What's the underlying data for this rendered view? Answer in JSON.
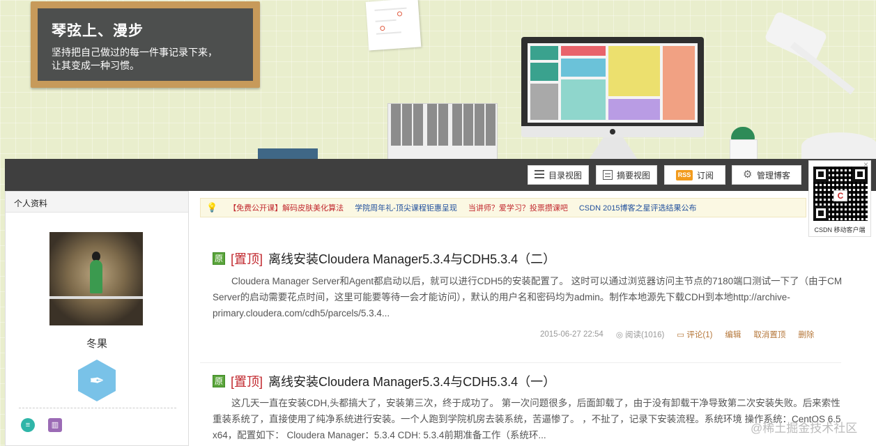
{
  "banner": {
    "title": "琴弦上、漫步",
    "subtitle_line1": "坚持把自己做过的每一件事记录下来，",
    "subtitle_line2": "让其变成一种习惯。"
  },
  "toolbar": {
    "catalog_view": "目录视图",
    "summary_view": "摘要视图",
    "rss_badge": "RSS",
    "subscribe": "订阅",
    "manage": "管理博客"
  },
  "qrcode": {
    "logo": "C",
    "caption": "CSDN 移动客户端",
    "close": "×"
  },
  "sidebar": {
    "header": "个人资料",
    "username": "冬果"
  },
  "notice": {
    "items": [
      {
        "text": "【免费公开课】解码皮肤美化算法",
        "color": "#c1272d"
      },
      {
        "text": "学院周年礼-顶尖课程钜惠呈现",
        "color": "#1f4e9c"
      },
      {
        "text": "当讲师？爱学习？投票攒课吧",
        "color": "#c1272d"
      },
      {
        "text": "CSDN 2015博客之星评选结果公布",
        "color": "#1f4e9c"
      }
    ]
  },
  "posts": [
    {
      "orig_label": "原",
      "top_label": "[置顶]",
      "title": "离线安装Cloudera Manager5.3.4与CDH5.3.4（二）",
      "excerpt": "Cloudera Manager Server和Agent都启动以后，就可以进行CDH5的安装配置了。 这时可以通过浏览器访问主节点的7180端口测试一下了（由于CM Server的启动需要花点时间，这里可能要等待一会才能访问），默认的用户名和密码均为admin。制作本地源先下载CDH到本地http://archive-primary.cloudera.com/cdh5/parcels/5.3.4...",
      "date": "2015-06-27 22:54",
      "reads": "阅读(1016)",
      "comments": "评论(1)",
      "edit": "编辑",
      "unpin": "取消置顶",
      "delete": "删除"
    },
    {
      "orig_label": "原",
      "top_label": "[置顶]",
      "title": "离线安装Cloudera Manager5.3.4与CDH5.3.4（一）",
      "excerpt": "这几天一直在安装CDH,头都搞大了，安装第三次，终于成功了。 第一次问题很多，后面卸载了，由于没有卸载干净导致第二次安装失败。后来索性重装系统了，直接使用了纯净系统进行安装。一个人跑到学院机房去装系统，苦逼惨了。 ，不扯了，记录下安装流程。系统环境 操作系统：CentOS 6.5 x64，配置如下： Cloudera Manager：5.3.4 CDH: 5.3.4前期准备工作（系统环..."
    }
  ],
  "watermark": "@稀土掘金技术社区",
  "colors": {
    "toolbar": "#3f3f3f",
    "accent_red": "#c1272d",
    "link_brown": "#b5773a",
    "orig_green": "#5aa43b"
  }
}
